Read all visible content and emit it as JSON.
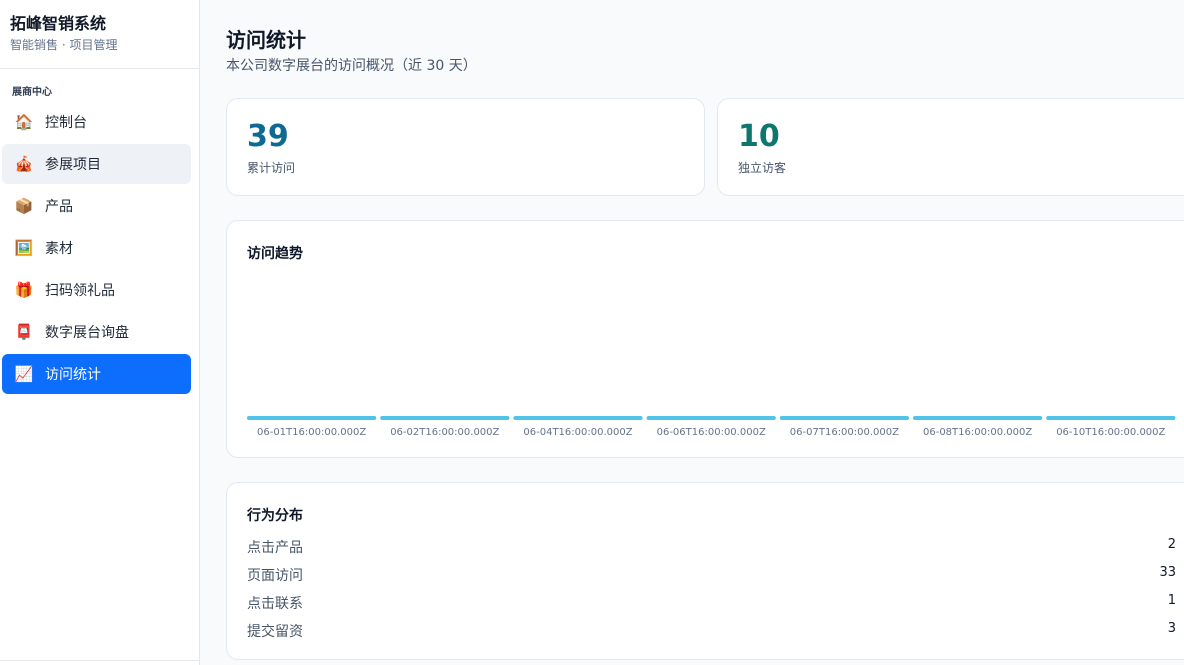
{
  "brand": {
    "title": "拓峰智销系统",
    "subtitle": "智能销售 · 项目管理"
  },
  "sidebar": {
    "section_label": "展商中心",
    "items": [
      {
        "label": "控制台",
        "icon": "house-icon",
        "glyph": "🏠"
      },
      {
        "label": "参展项目",
        "icon": "tent-icon",
        "glyph": "🎪"
      },
      {
        "label": "产品",
        "icon": "package-icon",
        "glyph": "📦"
      },
      {
        "label": "素材",
        "icon": "picture-icon",
        "glyph": "🖼️"
      },
      {
        "label": "扫码领礼品",
        "icon": "gift-icon",
        "glyph": "🎁"
      },
      {
        "label": "数字展台询盘",
        "icon": "inbox-icon",
        "glyph": "📮"
      },
      {
        "label": "访问统计",
        "icon": "chart-increasing-icon",
        "glyph": "📈"
      }
    ],
    "active_index": 6,
    "hover_index": 1
  },
  "page": {
    "title": "访问统计",
    "subtitle": "本公司数字展台的访问概况（近 30 天）"
  },
  "stats": [
    {
      "value": "39",
      "label": "累计访问",
      "color": "#0e6a91"
    },
    {
      "value": "10",
      "label": "独立访客",
      "color": "#0f766e"
    }
  ],
  "chart_data": {
    "type": "bar",
    "title": "访问趋势",
    "categories": [
      "06-01T16:00:00.000Z",
      "06-02T16:00:00.000Z",
      "06-04T16:00:00.000Z",
      "06-06T16:00:00.000Z",
      "06-07T16:00:00.000Z",
      "06-08T16:00:00.000Z",
      "06-10T16:00:00.000Z"
    ],
    "values": [
      1,
      1,
      1,
      1,
      1,
      1,
      1
    ],
    "ylim": [
      0,
      39
    ],
    "bar_color": "#4fc3e8",
    "grid": false
  },
  "behavior": {
    "title": "行为分布",
    "rows": [
      {
        "label": "点击产品",
        "value": "2"
      },
      {
        "label": "页面访问",
        "value": "33"
      },
      {
        "label": "点击联系",
        "value": "1"
      },
      {
        "label": "提交留资",
        "value": "3"
      }
    ]
  }
}
